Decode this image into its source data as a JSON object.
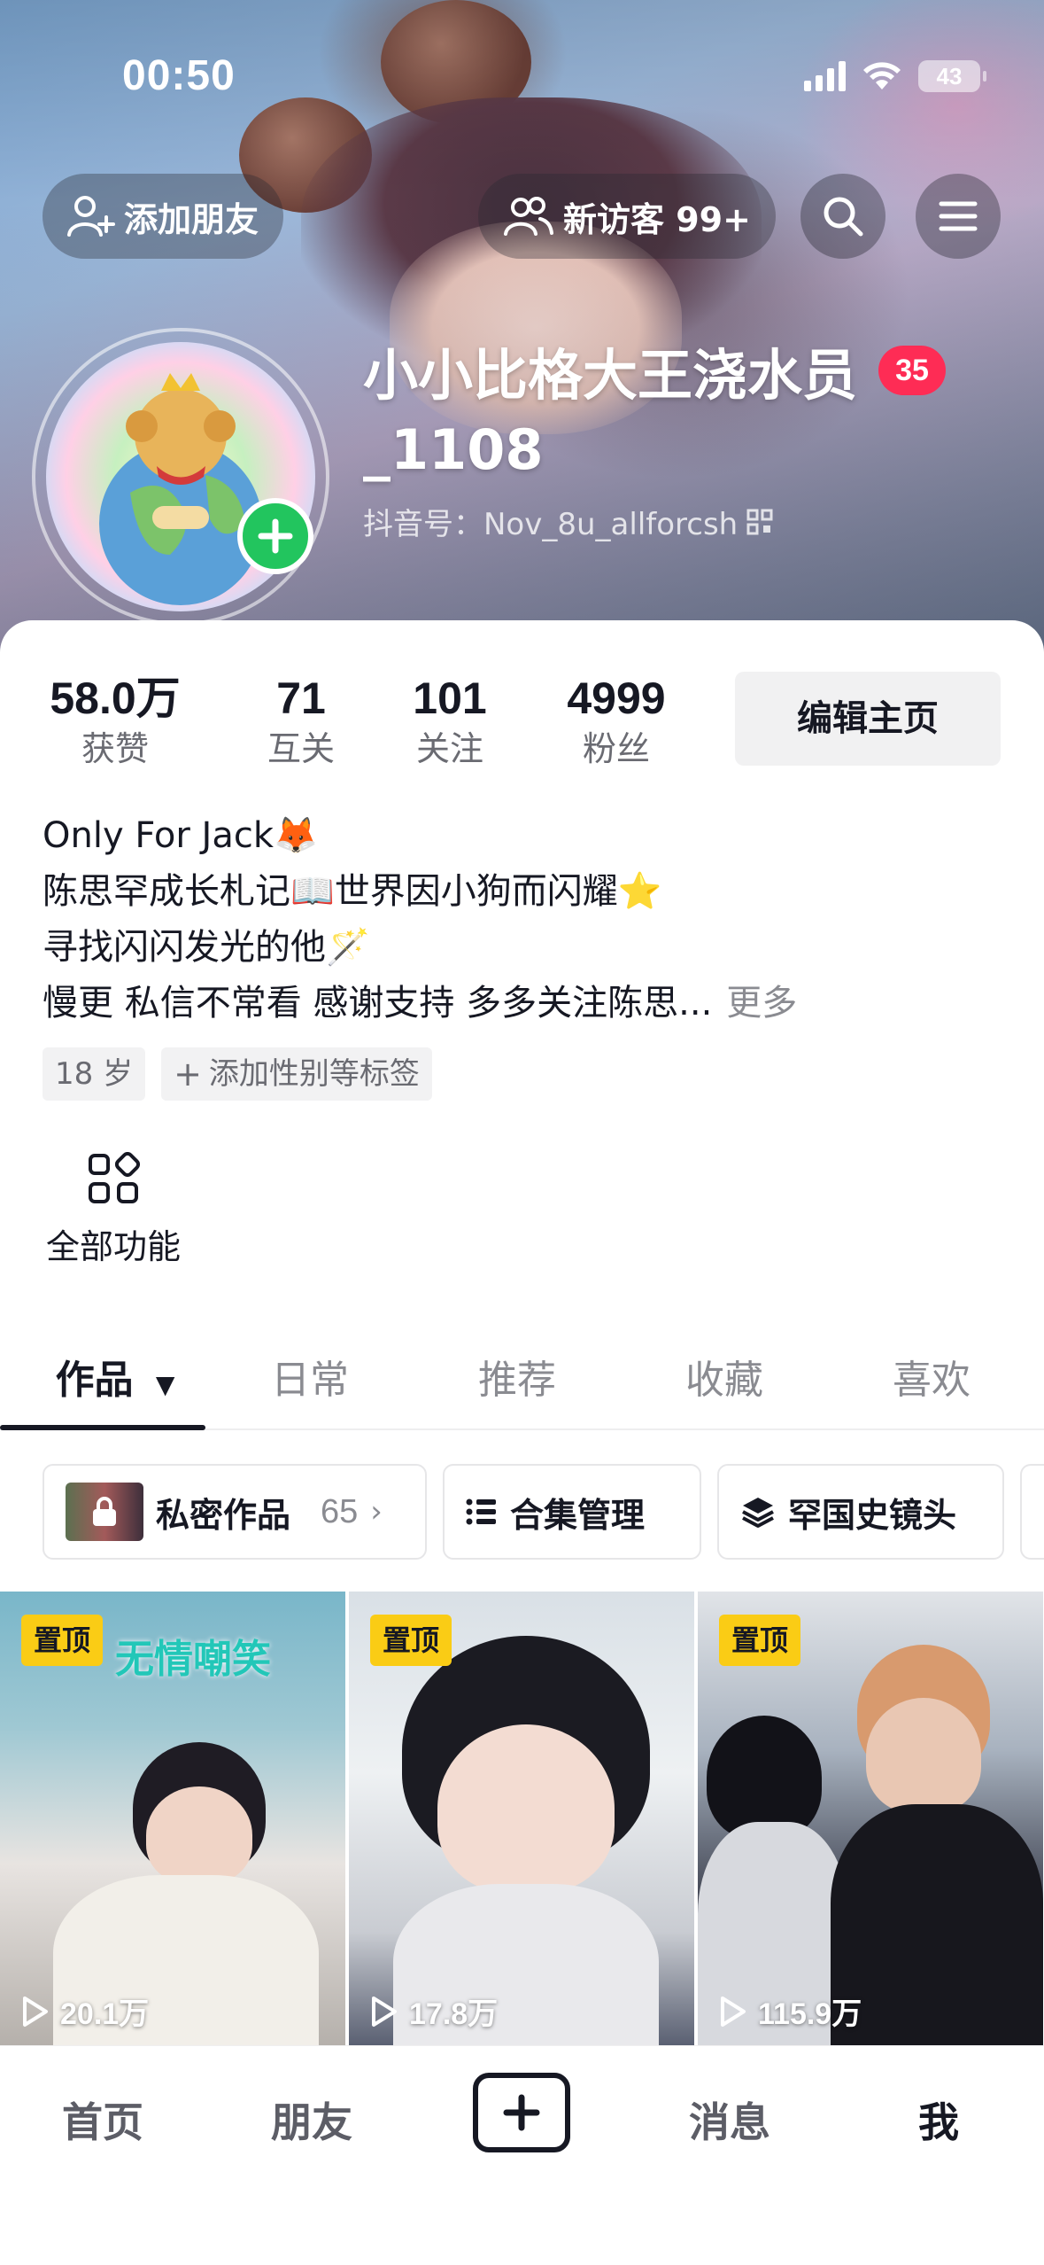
{
  "status_bar": {
    "time": "00:50",
    "battery": "43"
  },
  "header": {
    "add_friend_label": "添加朋友",
    "new_visitors_label": "新访客 99+",
    "search_icon": "search-icon",
    "menu_icon": "menu-icon"
  },
  "profile": {
    "nickname": "小小比格大王浇水员_1108",
    "level": "35",
    "douyin_id": "抖音号：Nov_8u_allforcsh"
  },
  "stats": [
    {
      "value": "58.0万",
      "label": "获赞"
    },
    {
      "value": "71",
      "label": "互关"
    },
    {
      "value": "101",
      "label": "关注"
    },
    {
      "value": "4999",
      "label": "粉丝"
    }
  ],
  "edit_button": "编辑主页",
  "bio": {
    "lines": [
      "Only For Jack🦊",
      "陈思罕成长札记📖世界因小狗而闪耀⭐",
      "寻找闪闪发光的他🪄",
      "慢更 私信不常看 感谢支持 多多关注陈思..."
    ],
    "more": "更多"
  },
  "tags": {
    "age": "18 岁",
    "add_tags": "添加性别等标签"
  },
  "all_functions": "全部功能",
  "tabs": [
    "作品",
    "日常",
    "推荐",
    "收藏",
    "喜欢"
  ],
  "shortcuts": {
    "private_label": "私密作品",
    "private_count": "65",
    "collection_label": "合集管理",
    "history_label": "罕国史镜头"
  },
  "videos": [
    {
      "pin": "置顶",
      "plays": "20.1万",
      "overlay_title": "无情嘲笑"
    },
    {
      "pin": "置顶",
      "plays": "17.8万"
    },
    {
      "pin": "置顶",
      "plays": "115.9万"
    }
  ],
  "bottom_nav": {
    "home": "首页",
    "friends": "朋友",
    "messages": "消息",
    "me": "我"
  },
  "colors": {
    "accent_red": "#fe2c55",
    "pin_yellow": "#facc15",
    "follow_green": "#22c55e"
  }
}
